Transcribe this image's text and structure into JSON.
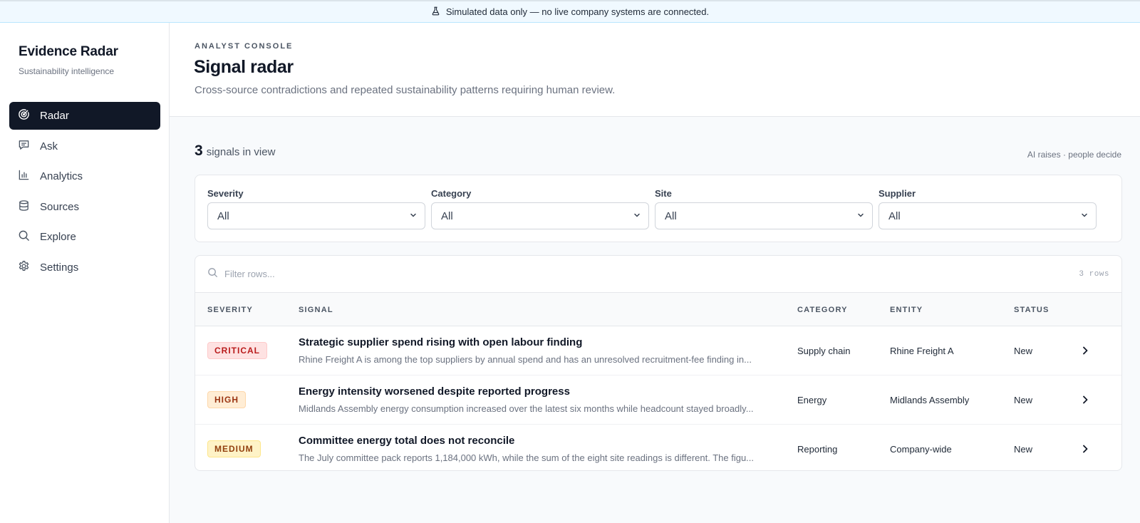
{
  "banner": {
    "text": "Simulated data only — no live company systems are connected.",
    "icon": "flask-icon"
  },
  "sidebar": {
    "title": "Evidence Radar",
    "subtitle": "Sustainability intelligence",
    "items": [
      {
        "label": "Radar",
        "icon": "radar-icon",
        "active": true
      },
      {
        "label": "Ask",
        "icon": "chat-icon"
      },
      {
        "label": "Analytics",
        "icon": "bar-chart-icon"
      },
      {
        "label": "Sources",
        "icon": "database-icon"
      },
      {
        "label": "Explore",
        "icon": "search-icon"
      },
      {
        "label": "Settings",
        "icon": "gear-icon"
      }
    ]
  },
  "header": {
    "eyebrow": "ANALYST CONSOLE",
    "title": "Signal radar",
    "description": "Cross-source contradictions and repeated sustainability patterns requiring human review."
  },
  "summary": {
    "count": "3",
    "count_label": "signals in view",
    "tagline": "AI raises · people decide"
  },
  "filters": [
    {
      "label": "Severity",
      "value": "All"
    },
    {
      "label": "Category",
      "value": "All"
    },
    {
      "label": "Site",
      "value": "All"
    },
    {
      "label": "Supplier",
      "value": "All"
    }
  ],
  "table": {
    "search_placeholder": "Filter rows...",
    "row_count": "3 rows",
    "columns": [
      "SEVERITY",
      "SIGNAL",
      "CATEGORY",
      "ENTITY",
      "STATUS"
    ],
    "rows": [
      {
        "severity": "CRITICAL",
        "title": "Strategic supplier spend rising with open labour finding",
        "description": "Rhine Freight A is among the top suppliers by annual spend and has an unresolved recruitment-fee finding in...",
        "category": "Supply chain",
        "entity": "Rhine Freight A",
        "status": "New"
      },
      {
        "severity": "HIGH",
        "title": "Energy intensity worsened despite reported progress",
        "description": "Midlands Assembly energy consumption increased over the latest six months while headcount stayed broadly...",
        "category": "Energy",
        "entity": "Midlands Assembly",
        "status": "New"
      },
      {
        "severity": "MEDIUM",
        "title": "Committee energy total does not reconcile",
        "description": "The July committee pack reports 1,184,000 kWh, while the sum of the eight site readings is different. The figu...",
        "category": "Reporting",
        "entity": "Company-wide",
        "status": "New"
      }
    ]
  },
  "colors": {
    "sidebar_active_bg": "#111827",
    "banner_bg": "#f0f9ff",
    "critical": "#b91c1c",
    "high": "#9a3412",
    "medium": "#92400e"
  }
}
